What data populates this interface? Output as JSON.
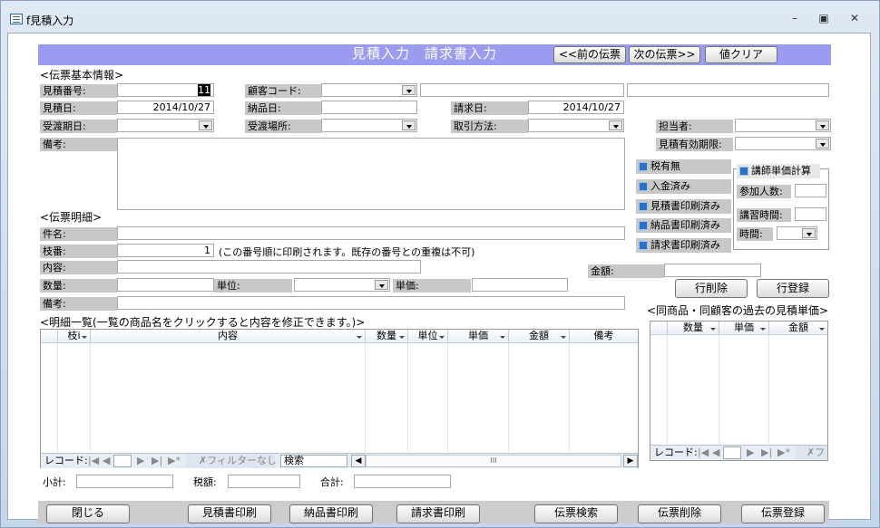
{
  "window": {
    "title": "f見積入力",
    "min_icon": "minimize-icon",
    "max_icon": "maximize-icon",
    "close_icon": "close-icon"
  },
  "header": {
    "title": "見積入力　請求書入力",
    "prev_button": "<<前の伝票",
    "next_button": "次の伝票>>",
    "clear_button": "値クリア"
  },
  "basic": {
    "section_label": "<伝票基本情報>",
    "estimate_no_label": "見積番号:",
    "estimate_no": "11",
    "customer_code_label": "顧客コード:",
    "estimate_date_label": "見積日:",
    "estimate_date": "2014/10/27",
    "delivery_date_label": "納品日:",
    "invoice_date_label": "請求日:",
    "invoice_date": "2014/10/27",
    "handover_date_label": "受渡期日:",
    "handover_place_label": "受渡場所:",
    "payment_label": "取引方法:",
    "staff_label": "担当者:",
    "validity_label": "見積有効期限:",
    "remarks_label": "備考:"
  },
  "checks": {
    "tax": "税有無",
    "paid": "入金済み",
    "estimate_printed": "見積書印刷済み",
    "delivery_printed": "納品書印刷済み",
    "invoice_printed": "請求書印刷済み"
  },
  "lecturer": {
    "title": "講師単価計算",
    "participants_label": "参加人数:",
    "hours_label": "講習時間:",
    "time_label": "時間:"
  },
  "detail": {
    "section_label": "<伝票明細>",
    "item_label": "件名:",
    "branch_label": "枝番:",
    "branch_value": "1",
    "branch_note": "(この番号順に印刷されます。既存の番号との重複は不可)",
    "content_label": "内容:",
    "amount_label": "金額:",
    "qty_label": "数量:",
    "unit_label": "単位:",
    "price_label": "単価:",
    "remarks_label": "備考:",
    "delete_row_button": "行削除",
    "add_row_button": "行登録"
  },
  "list": {
    "section_label": "<明細一覧(一覧の商品名をクリックすると内容を修正できます。)>",
    "columns": [
      "枝i",
      "内容",
      "数量",
      "単位",
      "単価",
      "金額",
      "備考"
    ],
    "nav_record_label": "レコード:",
    "filter_label": "フィルターなし",
    "search_placeholder": "検索",
    "scroll_mark": "III"
  },
  "history": {
    "section_label": "<同商品・同顧客の過去の見積単価>",
    "columns": [
      "数量",
      "単価",
      "金額"
    ],
    "nav_record_label": "レコード:",
    "filter_label": "フ"
  },
  "totals": {
    "subtotal_label": "小計:",
    "tax_label": "税額:",
    "total_label": "合計:"
  },
  "footer": {
    "close": "閉じる",
    "print_estimate": "見積書印刷",
    "print_delivery": "納品書印刷",
    "print_invoice": "請求書印刷",
    "search": "伝票検索",
    "delete": "伝票削除",
    "register": "伝票登録"
  },
  "colors": {
    "header_bar": "#9b9bf0",
    "label_bg": "#c8c8c8",
    "checkbox": "#2b73c2",
    "window_bg": "#c9d7e8"
  }
}
